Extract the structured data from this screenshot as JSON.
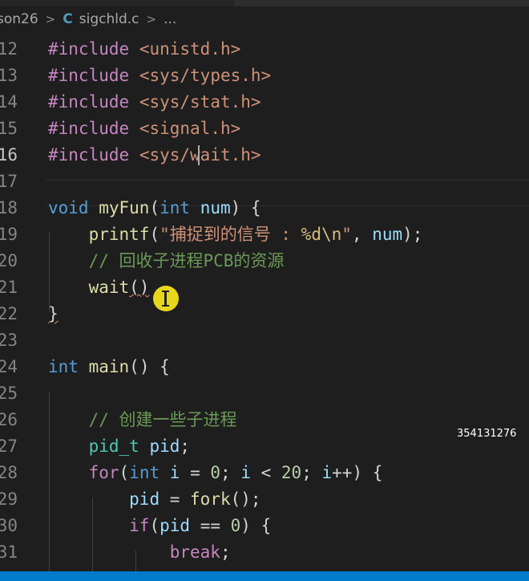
{
  "breadcrumb": {
    "folder": "son26",
    "sep": ">",
    "file_icon": "C",
    "file": "sigchld.c",
    "more": "..."
  },
  "lines": [
    {
      "n": "12",
      "t": [
        [
          "kw",
          "#include"
        ],
        [
          "pl",
          " "
        ],
        [
          "inc",
          "<unistd.h>"
        ]
      ]
    },
    {
      "n": "13",
      "t": [
        [
          "kw",
          "#include"
        ],
        [
          "pl",
          " "
        ],
        [
          "inc",
          "<sys/types.h>"
        ]
      ]
    },
    {
      "n": "14",
      "t": [
        [
          "kw",
          "#include"
        ],
        [
          "pl",
          " "
        ],
        [
          "inc",
          "<sys/stat.h>"
        ]
      ]
    },
    {
      "n": "15",
      "t": [
        [
          "kw",
          "#include"
        ],
        [
          "pl",
          " "
        ],
        [
          "inc",
          "<signal.h>"
        ]
      ]
    },
    {
      "n": "16",
      "t": [
        [
          "kw",
          "#include"
        ],
        [
          "pl",
          " "
        ],
        [
          "inc",
          "<sys/wait.h>"
        ]
      ],
      "active": true
    },
    {
      "n": "17",
      "t": []
    },
    {
      "n": "18",
      "t": [
        [
          "ty",
          "void"
        ],
        [
          "pl",
          " "
        ],
        [
          "fn",
          "myFun"
        ],
        [
          "pl",
          "("
        ],
        [
          "ty",
          "int"
        ],
        [
          "pl",
          " "
        ],
        [
          "var",
          "num"
        ],
        [
          "pl",
          ") {"
        ]
      ]
    },
    {
      "n": "19",
      "t": [
        [
          "pl",
          "    "
        ],
        [
          "fn",
          "printf"
        ],
        [
          "pl",
          "("
        ],
        [
          "str",
          "\"捕捉到的信号 : "
        ],
        [
          "esc",
          "%d\\n"
        ],
        [
          "str",
          "\""
        ],
        [
          "pl",
          ", "
        ],
        [
          "var",
          "num"
        ],
        [
          "pl",
          ");"
        ]
      ]
    },
    {
      "n": "20",
      "t": [
        [
          "pl",
          "    "
        ],
        [
          "cm",
          "// 回收子进程PCB的资源"
        ]
      ]
    },
    {
      "n": "21",
      "t": [
        [
          "pl",
          "    "
        ],
        [
          "fn",
          "wait"
        ],
        [
          "pl",
          "()"
        ]
      ]
    },
    {
      "n": "22",
      "t": [
        [
          "pl",
          "}"
        ]
      ]
    },
    {
      "n": "23",
      "t": []
    },
    {
      "n": "24",
      "t": [
        [
          "ty",
          "int"
        ],
        [
          "pl",
          " "
        ],
        [
          "fn",
          "main"
        ],
        [
          "pl",
          "() {"
        ]
      ]
    },
    {
      "n": "25",
      "t": []
    },
    {
      "n": "26",
      "t": [
        [
          "pl",
          "    "
        ],
        [
          "cm",
          "// 创建一些子进程"
        ]
      ]
    },
    {
      "n": "27",
      "t": [
        [
          "pl",
          "    "
        ],
        [
          "tt",
          "pid_t"
        ],
        [
          "pl",
          " "
        ],
        [
          "var",
          "pid"
        ],
        [
          "pl",
          ";"
        ]
      ]
    },
    {
      "n": "28",
      "t": [
        [
          "pl",
          "    "
        ],
        [
          "kw",
          "for"
        ],
        [
          "pl",
          "("
        ],
        [
          "ty",
          "int"
        ],
        [
          "pl",
          " "
        ],
        [
          "var",
          "i"
        ],
        [
          "pl",
          " = "
        ],
        [
          "num",
          "0"
        ],
        [
          "pl",
          "; "
        ],
        [
          "var",
          "i"
        ],
        [
          "pl",
          " < "
        ],
        [
          "num",
          "20"
        ],
        [
          "pl",
          "; "
        ],
        [
          "var",
          "i"
        ],
        [
          "pl",
          "++) {"
        ]
      ]
    },
    {
      "n": "29",
      "t": [
        [
          "pl",
          "        "
        ],
        [
          "var",
          "pid"
        ],
        [
          "pl",
          " = "
        ],
        [
          "fn",
          "fork"
        ],
        [
          "pl",
          "();"
        ]
      ]
    },
    {
      "n": "30",
      "t": [
        [
          "pl",
          "        "
        ],
        [
          "kw",
          "if"
        ],
        [
          "pl",
          "("
        ],
        [
          "var",
          "pid"
        ],
        [
          "pl",
          " == "
        ],
        [
          "num",
          "0"
        ],
        [
          "pl",
          ") {"
        ]
      ]
    },
    {
      "n": "31",
      "t": [
        [
          "pl",
          "            "
        ],
        [
          "kw",
          "break"
        ],
        [
          "pl",
          ";"
        ]
      ]
    }
  ],
  "watermark": "354131276",
  "colors": {
    "background": "#1e1e1e",
    "keyword": "#c586c0",
    "type": "#569cd6",
    "function": "#dcdcaa",
    "variable": "#9cdcfe",
    "string": "#ce9178",
    "comment": "#6a9955",
    "number": "#b5cea8",
    "statusbar": "#007acc"
  }
}
